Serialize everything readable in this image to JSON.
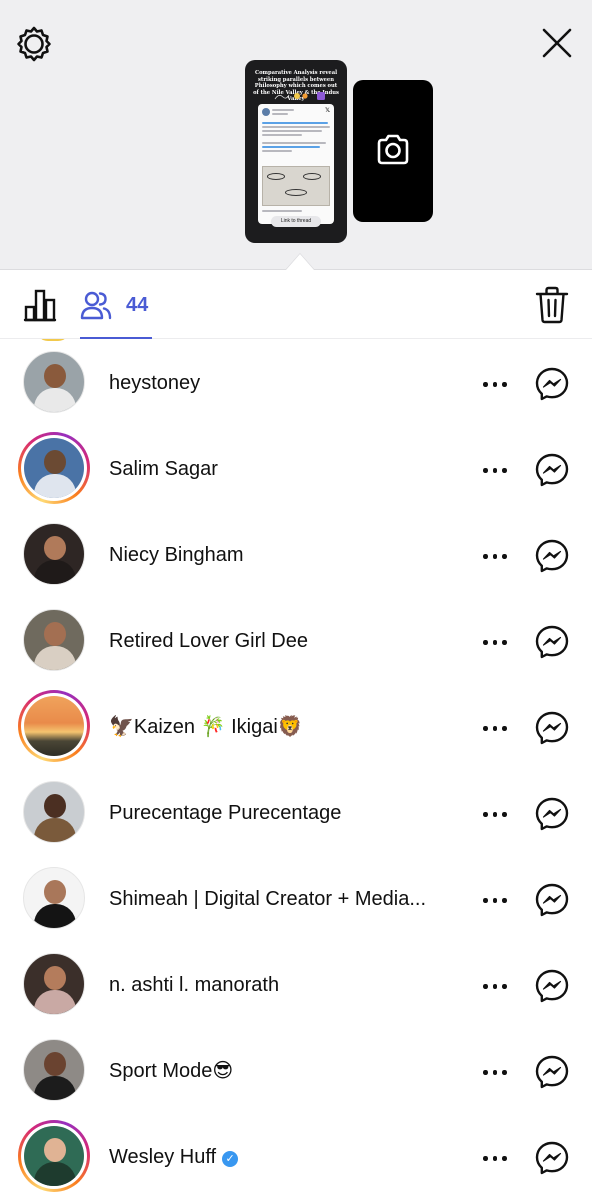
{
  "header": {
    "settings_icon": "gear-icon",
    "close_icon": "close-icon"
  },
  "story_preview": {
    "headline": "Comparative Analysis reveal striking parallels between Philosophy which comes out of the Nile Valley & the Indus Valley",
    "link_sticker": "Link to thread",
    "viewer_count": "44",
    "camera_icon": "camera-icon"
  },
  "tabs": {
    "insights_icon": "bar-chart-icon",
    "viewers_icon": "people-icon",
    "viewers_count": "44",
    "delete_icon": "trash-icon",
    "active": "viewers"
  },
  "viewers": [
    {
      "name": "heystoney",
      "ring": false,
      "verified": false,
      "avatar_bg": "#9aa3a8",
      "skin": "#8a5a3c",
      "shirt": "#e9e9e9"
    },
    {
      "name": "Salim Sagar",
      "ring": true,
      "verified": false,
      "avatar_bg": "#4a73a6",
      "skin": "#6b4a33",
      "shirt": "#dfe5ee"
    },
    {
      "name": "Niecy Bingham",
      "ring": false,
      "verified": false,
      "avatar_bg": "#2e2624",
      "skin": "#b07a5a",
      "shirt": "#1f1a19"
    },
    {
      "name": "Retired Lover Girl Dee",
      "ring": false,
      "verified": false,
      "avatar_bg": "#6f6a5e",
      "skin": "#a36f52",
      "shirt": "#d9cfc3"
    },
    {
      "name": "🦅Kaizen 🎋 Ikigai🦁",
      "ring": true,
      "verified": false,
      "avatar_bg": "#d98a4e",
      "skin": "#e7a35f",
      "shirt": "#3d3a2c",
      "sunset": true
    },
    {
      "name": "Purecentage Purecentage",
      "ring": false,
      "verified": false,
      "avatar_bg": "#c9cdd1",
      "skin": "#4b2f22",
      "shirt": "#7a5a3b"
    },
    {
      "name": "Shimeah | Digital Creator + Media...",
      "ring": false,
      "verified": false,
      "avatar_bg": "#f4f4f4",
      "skin": "#a9775a",
      "shirt": "#141414"
    },
    {
      "name": "n. ashti l. manorath",
      "ring": false,
      "verified": false,
      "avatar_bg": "#3b2f2a",
      "skin": "#b47c5c",
      "shirt": "#c9a9a4"
    },
    {
      "name": "Sport Mode😎",
      "ring": false,
      "verified": false,
      "avatar_bg": "#8e8a86",
      "skin": "#6a4330",
      "shirt": "#1c1c1c"
    },
    {
      "name": "Wesley Huff",
      "ring": true,
      "verified": true,
      "avatar_bg": "#2f6b55",
      "skin": "#e0b394",
      "shirt": "#1e3b2e"
    }
  ],
  "row_actions": {
    "more_icon": "more-dots-icon",
    "message_icon": "messenger-icon"
  },
  "colors": {
    "accent": "#4a5bd4",
    "verified": "#3897f0",
    "background_top": "#efeff1"
  }
}
